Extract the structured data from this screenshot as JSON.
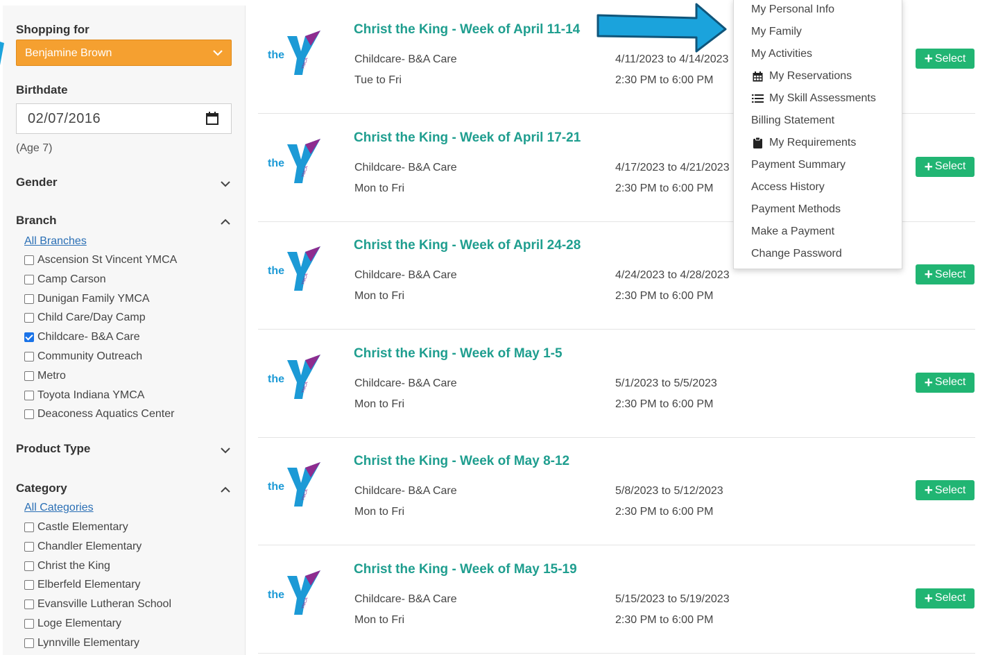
{
  "sidebar": {
    "shopping_for_label": "Shopping for",
    "shopping_for_value": "Benjamine Brown",
    "birthdate_label": "Birthdate",
    "birthdate_value": "02/07/2016",
    "age_text": "(Age 7)",
    "gender_label": "Gender",
    "branch_label": "Branch",
    "all_branches_link": "All Branches",
    "branches": [
      {
        "label": "Ascension St Vincent YMCA",
        "checked": false
      },
      {
        "label": "Camp Carson",
        "checked": false
      },
      {
        "label": "Dunigan Family YMCA",
        "checked": false
      },
      {
        "label": "Child Care/Day Camp",
        "checked": false
      },
      {
        "label": "Childcare- B&A Care",
        "checked": true
      },
      {
        "label": "Community Outreach",
        "checked": false
      },
      {
        "label": "Metro",
        "checked": false
      },
      {
        "label": "Toyota Indiana YMCA",
        "checked": false
      },
      {
        "label": "Deaconess Aquatics Center",
        "checked": false
      }
    ],
    "product_type_label": "Product Type",
    "category_label": "Category",
    "all_categories_link": "All Categories",
    "categories": [
      {
        "label": "Castle Elementary",
        "checked": false
      },
      {
        "label": "Chandler Elementary",
        "checked": false
      },
      {
        "label": "Christ the King",
        "checked": false
      },
      {
        "label": "Elberfeld Elementary",
        "checked": false
      },
      {
        "label": "Evansville Lutheran School",
        "checked": false
      },
      {
        "label": "Loge Elementary",
        "checked": false
      },
      {
        "label": "Lynnville Elementary",
        "checked": false
      }
    ]
  },
  "logo_text": "the",
  "logo_small_text": "YMCA",
  "results": [
    {
      "title": "Christ the King - Week of April 11-14",
      "program": "Childcare- B&A Care",
      "days": "Tue to Fri",
      "dates": "4/11/2023 to 4/14/2023",
      "time": "2:30 PM to 6:00 PM",
      "button": "Select"
    },
    {
      "title": "Christ the King - Week of April 17-21",
      "program": "Childcare- B&A Care",
      "days": "Mon to Fri",
      "dates": "4/17/2023 to 4/21/2023",
      "time": "2:30 PM to 6:00 PM",
      "button": "Select"
    },
    {
      "title": "Christ the King - Week of April 24-28",
      "program": "Childcare- B&A Care",
      "days": "Mon to Fri",
      "dates": "4/24/2023 to 4/28/2023",
      "time": "2:30 PM to 6:00 PM",
      "button": "Select"
    },
    {
      "title": "Christ the King - Week of May 1-5",
      "program": "Childcare- B&A Care",
      "days": "Mon to Fri",
      "dates": "5/1/2023 to 5/5/2023",
      "time": "2:30 PM to 6:00 PM",
      "button": "Select"
    },
    {
      "title": "Christ the King - Week of May 8-12",
      "program": "Childcare- B&A Care",
      "days": "Mon to Fri",
      "dates": "5/8/2023 to 5/12/2023",
      "time": "2:30 PM to 6:00 PM",
      "button": "Select"
    },
    {
      "title": "Christ the King - Week of May 15-19",
      "program": "Childcare- B&A Care",
      "days": "Mon to Fri",
      "dates": "5/15/2023 to 5/19/2023",
      "time": "2:30 PM to 6:00 PM",
      "button": "Select"
    }
  ],
  "account_menu": {
    "items": [
      {
        "label": "My Personal Info",
        "icon": ""
      },
      {
        "label": "My Family",
        "icon": ""
      },
      {
        "label": "My Activities",
        "icon": ""
      },
      {
        "label": "My Reservations",
        "icon": "calendar-icon"
      },
      {
        "label": "My Skill Assessments",
        "icon": "list-icon"
      },
      {
        "label": "Billing Statement",
        "icon": ""
      },
      {
        "label": "My Requirements",
        "icon": "clipboard-icon"
      },
      {
        "label": "Payment Summary",
        "icon": ""
      },
      {
        "label": "Access History",
        "icon": ""
      },
      {
        "label": "Payment Methods",
        "icon": ""
      },
      {
        "label": "Make a Payment",
        "icon": ""
      },
      {
        "label": "Change Password",
        "icon": ""
      }
    ]
  },
  "colors": {
    "accent_orange": "#f5a030",
    "title_teal": "#1f9e8f",
    "select_green": "#21b573",
    "arrow_blue": "#1ba3dc",
    "ymca_purple": "#8e2c8f",
    "ymca_blue": "#1c9ad6"
  }
}
